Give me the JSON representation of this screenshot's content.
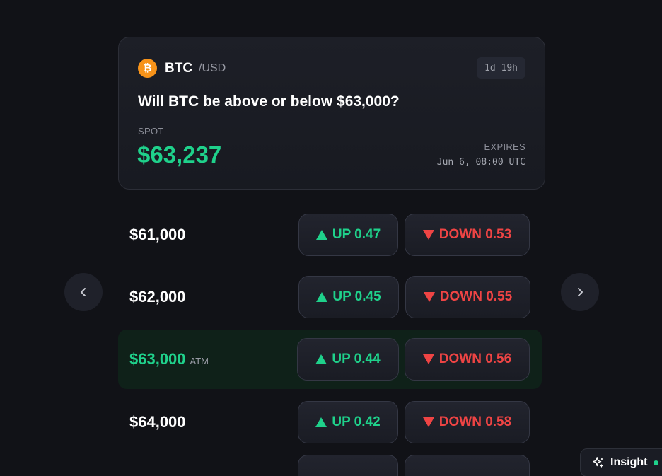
{
  "market": {
    "coin_symbol": "₿",
    "ticker": "BTC",
    "pair": "/USD",
    "time_left": "1d 19h",
    "question": "Will BTC be above or below $63,000?",
    "spot_label": "SPOT",
    "spot_value": "$63,237",
    "expires_label": "EXPIRES",
    "expires_value": "Jun 6, 08:00 UTC"
  },
  "nav": {
    "prev_icon": "chevron-left-icon",
    "next_icon": "chevron-right-icon"
  },
  "strikes": [
    {
      "strike": "$61,000",
      "tag": "",
      "up": "UP 0.47",
      "down": "DOWN 0.53"
    },
    {
      "strike": "$62,000",
      "tag": "",
      "up": "UP 0.45",
      "down": "DOWN 0.55"
    },
    {
      "strike": "$63,000",
      "tag": "ATM",
      "up": "UP 0.44",
      "down": "DOWN 0.56"
    },
    {
      "strike": "$64,000",
      "tag": "",
      "up": "UP 0.42",
      "down": "DOWN 0.58"
    },
    {
      "strike": "",
      "tag": "",
      "up": "",
      "down": ""
    }
  ],
  "insight": {
    "label": "Insight",
    "icon": "sparkle-icon"
  },
  "colors": {
    "up": "#1fd18b",
    "down": "#ef4444",
    "coin": "#f7931a",
    "background": "#111217"
  }
}
